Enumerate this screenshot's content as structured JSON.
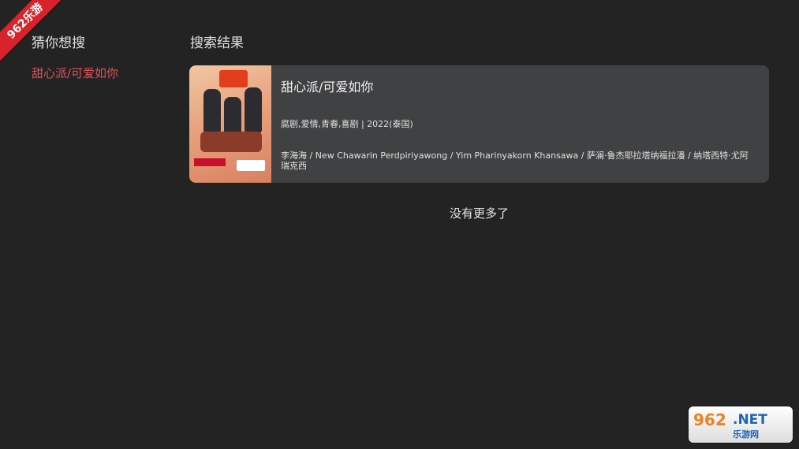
{
  "watermark_corner": "962乐游",
  "left": {
    "title": "猜你想搜",
    "suggestions": [
      "甜心派/可爱如你"
    ]
  },
  "right": {
    "title": "搜索结果",
    "results": [
      {
        "title": "甜心派/可爱如你",
        "meta": "腐剧,爱情,青春,喜剧 | 2022(泰国)",
        "cast": " 李海海 / New Chawarin Perdpiriyawong / Yim Pharinyakorn Khansawa / 萨澜·鲁杰耶拉塔纳福拉潘 / 纳塔西特·尤阿瑞克西"
      }
    ],
    "end_text": "没有更多了"
  },
  "watermark": {
    "big": "962",
    "brand": ".NET",
    "sub": "乐游网"
  },
  "colors": {
    "background": "#232323",
    "accent": "#e0505a",
    "card": "#404142",
    "corner": "#d9232a"
  }
}
